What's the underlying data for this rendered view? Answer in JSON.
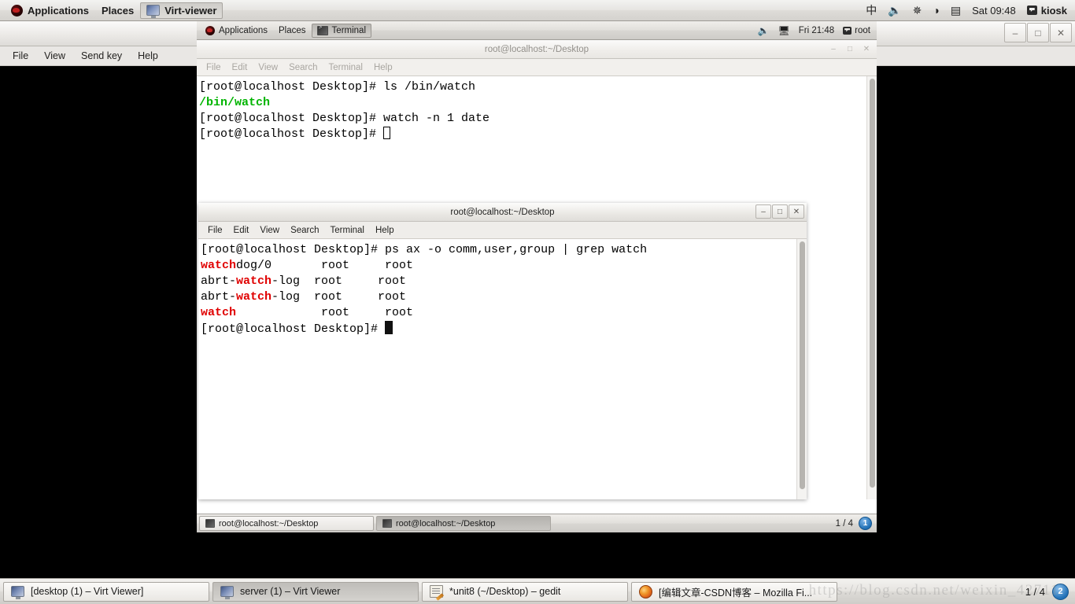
{
  "host_panel": {
    "applications_label": "Applications",
    "places_label": "Places",
    "active_window_label": "Virt-viewer",
    "input_method": "中",
    "volume_icon": "🔊",
    "bluetooth_icon": "✳",
    "wifi_icon": "◗",
    "battery_icon": "▤",
    "clock": "Sat 09:48",
    "user": "kiosk"
  },
  "virt_viewer": {
    "title": "server (1) – Virt Viewer",
    "menu": [
      "File",
      "View",
      "Send key",
      "Help"
    ],
    "window_buttons": {
      "minimize": "–",
      "maximize": "□",
      "close": "✕"
    }
  },
  "guest_panel": {
    "applications_label": "Applications",
    "places_label": "Places",
    "active_window_label": "Terminal",
    "volume_icon": "🔊",
    "network_icon": "🖧",
    "clock": "Fri 21:48",
    "user": "root"
  },
  "terminal_back": {
    "title": "root@localhost:~/Desktop",
    "menu": [
      "File",
      "Edit",
      "View",
      "Search",
      "Terminal",
      "Help"
    ],
    "window_buttons": {
      "minimize": "–",
      "maximize": "□",
      "close": "✕"
    },
    "lines": [
      {
        "segments": [
          {
            "text": "[root@localhost Desktop]# ls /bin/watch",
            "color": "default"
          }
        ]
      },
      {
        "segments": [
          {
            "text": "/bin/watch",
            "color": "green"
          }
        ]
      },
      {
        "segments": [
          {
            "text": "[root@localhost Desktop]# watch -n 1 date",
            "color": "default"
          }
        ]
      },
      {
        "segments": [
          {
            "text": "[root@localhost Desktop]# ",
            "color": "default"
          }
        ],
        "cursor": "hollow"
      }
    ]
  },
  "terminal_front": {
    "title": "root@localhost:~/Desktop",
    "menu": [
      "File",
      "Edit",
      "View",
      "Search",
      "Terminal",
      "Help"
    ],
    "window_buttons": {
      "minimize": "–",
      "maximize": "□",
      "close": "✕"
    },
    "lines": [
      {
        "segments": [
          {
            "text": "[root@localhost Desktop]# ps ax -o comm,user,group | grep watch",
            "color": "default"
          }
        ]
      },
      {
        "segments": [
          {
            "text": "watch",
            "color": "red"
          },
          {
            "text": "dog/0       root     root",
            "color": "default"
          }
        ]
      },
      {
        "segments": [
          {
            "text": "abrt-",
            "color": "default"
          },
          {
            "text": "watch",
            "color": "red"
          },
          {
            "text": "-log  root     root",
            "color": "default"
          }
        ]
      },
      {
        "segments": [
          {
            "text": "abrt-",
            "color": "default"
          },
          {
            "text": "watch",
            "color": "red"
          },
          {
            "text": "-log  root     root",
            "color": "default"
          }
        ]
      },
      {
        "segments": [
          {
            "text": "watch",
            "color": "red"
          },
          {
            "text": "            root     root",
            "color": "default"
          }
        ]
      },
      {
        "segments": [
          {
            "text": "[root@localhost Desktop]# ",
            "color": "default"
          }
        ],
        "cursor": "block"
      }
    ]
  },
  "guest_taskbar": {
    "tasks": [
      {
        "label": "root@localhost:~/Desktop",
        "active": false
      },
      {
        "label": "root@localhost:~/Desktop",
        "active": true
      }
    ],
    "pager": "1 / 4",
    "workspace": "1"
  },
  "host_taskbar": {
    "tasks": [
      {
        "label": "[desktop (1) – Virt Viewer]",
        "icon": "monitor-icon",
        "active": false
      },
      {
        "label": "server (1) – Virt Viewer",
        "icon": "monitor-icon",
        "active": true
      },
      {
        "label": "*unit8 (~/Desktop) – gedit",
        "icon": "gedit-icon",
        "active": false
      },
      {
        "label": "[编辑文章-CSDN博客 – Mozilla Fi...",
        "icon": "firefox-icon",
        "active": false
      }
    ],
    "pager": "1 / 4",
    "workspace": "2"
  },
  "watermark": {
    "text": "https://blog.csdn.net/weixin_42711"
  },
  "colors": {
    "terminal_green": "#00b400",
    "terminal_red": "#e00000",
    "panel_bg": "#e2e0dc",
    "canvas_black": "#000000"
  }
}
